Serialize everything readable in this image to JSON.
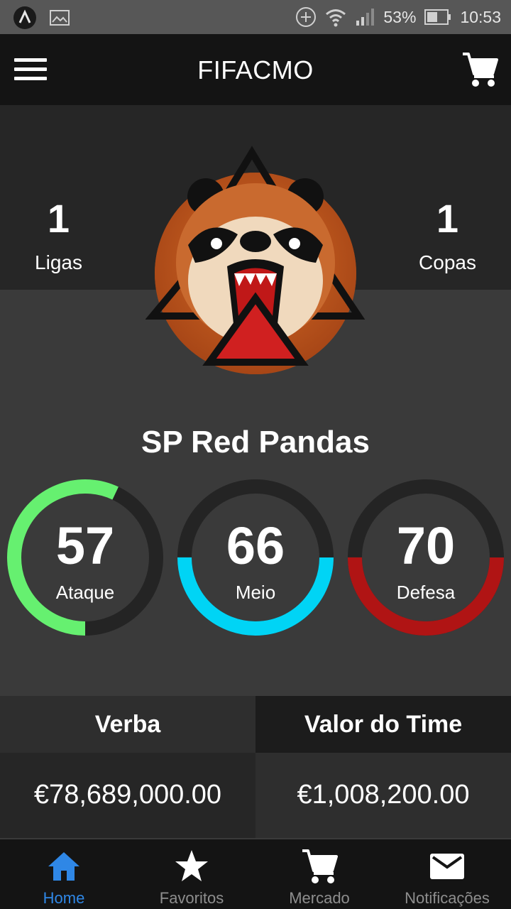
{
  "status_bar": {
    "battery": "53%",
    "time": "10:53"
  },
  "app_bar": {
    "title": "FIFACMO",
    "icons": {
      "menu": "hamburger-menu-icon",
      "cart": "cart-icon"
    }
  },
  "stats": {
    "left": {
      "value": "1",
      "label": "Ligas"
    },
    "right": {
      "value": "1",
      "label": "Copas"
    }
  },
  "team": {
    "name": "SP Red Pandas",
    "logo": "red-panda-logo"
  },
  "gauges": [
    {
      "value": "57",
      "label": "Ataque",
      "percent": 57,
      "color": "#66f070"
    },
    {
      "value": "66",
      "label": "Meio",
      "percent": 50,
      "color": "#00d4f5"
    },
    {
      "value": "70",
      "label": "Defesa",
      "percent": 50,
      "color": "#b01414"
    }
  ],
  "finance": {
    "budget_label": "Verba",
    "budget_value": "€78,689,000.00",
    "team_value_label": "Valor do Time",
    "team_value": "€1,008,200.00"
  },
  "bottom_nav": [
    {
      "label": "Home",
      "icon": "home-icon",
      "active": true
    },
    {
      "label": "Favoritos",
      "icon": "star-icon",
      "active": false
    },
    {
      "label": "Mercado",
      "icon": "cart-icon",
      "active": false
    },
    {
      "label": "Notificações",
      "icon": "mail-icon",
      "active": false
    }
  ],
  "colors": {
    "active_nav": "#2f87e6",
    "appbar": "#141414",
    "background": "#3a3a3a"
  }
}
